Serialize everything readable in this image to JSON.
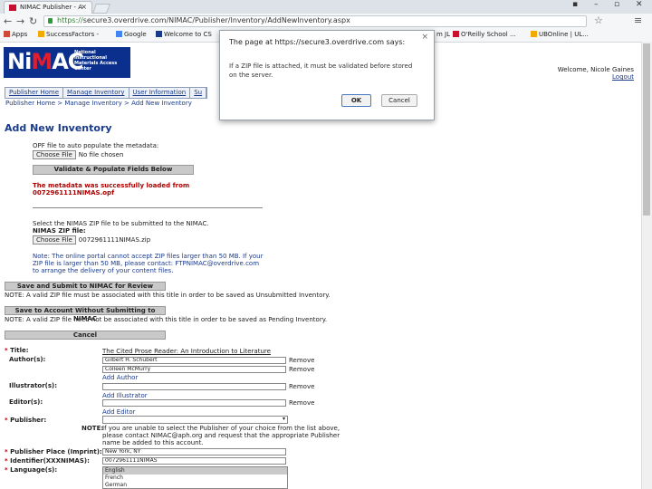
{
  "browser": {
    "tab_title": "NIMAC Publisher - A",
    "url_scheme": "https://",
    "url_rest": "secure3.overdrive.com/NIMAC/Publisher/Inventory/AddNewInventory.aspx",
    "bookmarks": [
      "Apps",
      "SuccessFactors -",
      "Google",
      "Welcome to CS",
      "m JL",
      "O'Reilly School ...",
      "UBOnline | UL..."
    ]
  },
  "header": {
    "logo_text": "NiMAC",
    "logo_sub": "National Instructional Materials Access Center",
    "welcome": "Welcome, Nicole Gaines",
    "logout": "Logout"
  },
  "nav": {
    "items": [
      "Publisher Home",
      "Manage Inventory",
      "User Information",
      "Su"
    ]
  },
  "breadcrumb": "Publisher Home > Manage Inventory > Add New Inventory",
  "page": {
    "title": "Add New Inventory",
    "opf_label": "OPF file to auto populate the metadata:",
    "choose_file": "Choose File",
    "no_file": "No file chosen",
    "validate_btn": "Validate & Populate Fields Below",
    "success_line1": "The metadata was successfully loaded from",
    "success_line2": "0072961111NIMAS.opf",
    "select_zip_text": "Select the NIMAS ZIP file to be submitted to the NIMAC.",
    "zip_label": "NIMAS ZIP file:",
    "zip_filename": "0072961111NIMAS.zip",
    "note1": "Note: The online portal cannot accept ZIP files larger than 50 MB. If your",
    "note2": "ZIP file is larger than 50 MB, please contact: FTPNIMAC@overdrive.com",
    "note3": "to arrange the delivery of your content files.",
    "save_submit_btn": "Save and Submit to NIMAC for Review",
    "save_submit_note": "NOTE: A valid ZIP file must be associated with this title in order to be saved as Unsubmitted Inventory.",
    "save_account_btn": "Save to Account Without Submitting to NIMAC",
    "save_account_note": "NOTE: A valid ZIP file need not be associated with this title in order to be saved as Pending Inventory.",
    "cancel_btn": "Cancel"
  },
  "form": {
    "title_label": "Title:",
    "title_value": "The Cited Prose Reader: An Introduction to Literature",
    "authors_label": "Author(s):",
    "authors": [
      "Gilbert H. Schubert",
      "Colleen McMurry"
    ],
    "remove": "Remove",
    "add_author": "Add Author",
    "illustrators_label": "Illustrator(s):",
    "add_illustrator": "Add Illustrator",
    "editors_label": "Editor(s):",
    "add_editor": "Add Editor",
    "publisher_label": "Publisher:",
    "publisher_note_label": "NOTE:",
    "publisher_note1": "If you are unable to select the Publisher of your choice from the list above,",
    "publisher_note2": "please contact NIMAC@aph.org and request that the appropriate Publisher",
    "publisher_note3": "name be added to this account.",
    "pub_place_label": "Publisher Place (Imprint):",
    "pub_place_value": "New York, NY",
    "identifier_label": "Identifier(XXXNIMAS):",
    "identifier_value": "0072961111NIMAS",
    "language_label": "Language(s):",
    "languages": [
      "English",
      "French",
      "German"
    ]
  },
  "dialog": {
    "title": "The page at https://secure3.overdrive.com says:",
    "message": "If a ZIP file is attached, it must be validated before stored on the server.",
    "ok": "OK",
    "cancel": "Cancel"
  }
}
